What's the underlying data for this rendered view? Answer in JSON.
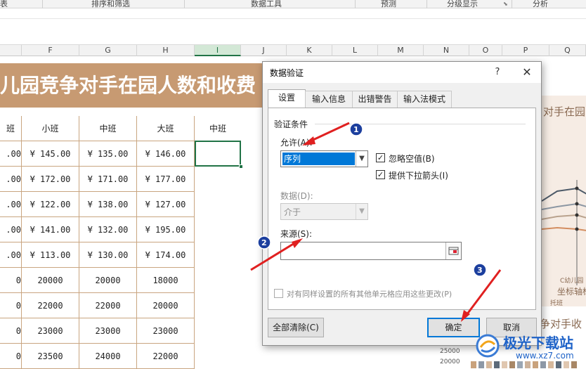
{
  "ribbon": {
    "groups": [
      "表",
      "排序和筛选",
      "数据工具",
      "预测",
      "分级显示",
      "分析"
    ]
  },
  "columns": [
    "F",
    "G",
    "H",
    "I",
    "J",
    "K",
    "L",
    "M",
    "N",
    "O",
    "P",
    "Q"
  ],
  "selected_column": "I",
  "sheet": {
    "banner_title": "儿园竞争对手在园人数和收费",
    "headers": [
      "班",
      "小班",
      "中班",
      "大班",
      "中班"
    ],
    "rows": [
      [
        ".00",
        "¥ 145.00",
        "¥ 135.00",
        "¥ 146.00"
      ],
      [
        ".00",
        "¥ 172.00",
        "¥ 171.00",
        "¥ 177.00"
      ],
      [
        ".00",
        "¥ 122.00",
        "¥ 138.00",
        "¥ 127.00"
      ],
      [
        ".00",
        "¥ 141.00",
        "¥ 132.00",
        "¥ 195.00"
      ],
      [
        ".00",
        "¥ 113.00",
        "¥ 130.00",
        "¥ 174.00"
      ],
      [
        "0",
        "20000",
        "20000",
        "18000"
      ],
      [
        "0",
        "22000",
        "22000",
        "20000"
      ],
      [
        "0",
        "23000",
        "23000",
        "23000"
      ],
      [
        "0",
        "23500",
        "24000",
        "22000"
      ]
    ]
  },
  "chart": {
    "title_top": "对手在园",
    "label_c": "C幼儿园",
    "axis_title": "坐标轴标",
    "tuoban": "托班",
    "title_bottom": "争对手收",
    "y_tick": "25000",
    "y_tick2": "20000"
  },
  "dialog": {
    "title": "数据验证",
    "help": "?",
    "close": "✕",
    "tabs": [
      "设置",
      "输入信息",
      "出错警告",
      "输入法模式"
    ],
    "active_tab": "设置",
    "group_label": "验证条件",
    "allow_label": "允许(A):",
    "allow_value": "序列",
    "ignore_blank_label": "忽略空值(B)",
    "ignore_blank_checked": true,
    "dropdown_label": "提供下拉箭头(I)",
    "dropdown_checked": true,
    "data_label": "数据(D):",
    "data_value": "介于",
    "source_label": "来源(S):",
    "source_value": "",
    "apply_all_label": "对有同样设置的所有其他单元格应用这些更改(P)",
    "apply_all_checked": false,
    "clear_all": "全部清除(C)",
    "ok": "确定",
    "cancel": "取消"
  },
  "annotations": {
    "badges": [
      "1",
      "2",
      "3"
    ]
  },
  "watermark": {
    "name": "极光下载站",
    "url": "www.xz7.com"
  },
  "colors": {
    "banner": "#c79a72",
    "accent_green": "#217346",
    "arrow_red": "#e02020",
    "badge_blue": "#1c3f9e",
    "selection_blue": "#0078d7"
  }
}
